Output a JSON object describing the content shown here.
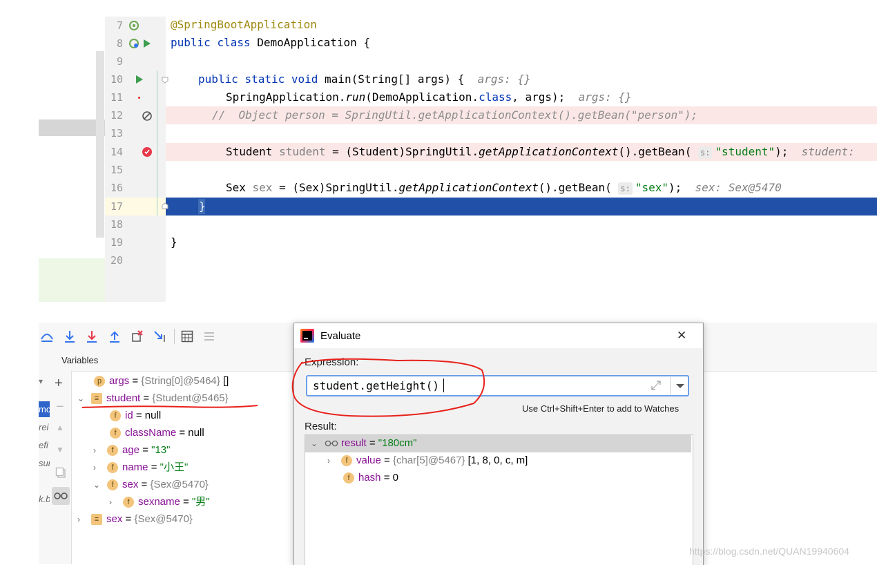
{
  "editor": {
    "line_numbers": [
      "7",
      "8",
      "9",
      "10",
      "11",
      "12",
      "13",
      "14",
      "15",
      "16",
      "17",
      "18",
      "19",
      "20"
    ],
    "lines": {
      "l7": "@SpringBootApplication",
      "l8_kw1": "public",
      "l8_kw2": "class",
      "l8_rest": " DemoApplication {",
      "l10_kw1": "public",
      "l10_kw2": "static",
      "l10_kw3": "void",
      "l10_rest": " main(String[] args) {",
      "l10_hint": "args: {}",
      "l11_a": "SpringApplication.",
      "l11_b": "run",
      "l11_c": "(DemoApplication.",
      "l11_d": "class",
      "l11_e": ", args);",
      "l11_hint": "args: {}",
      "l12": "//  Object person = SpringUtil.getApplicationContext().getBean(\"person\");",
      "l14_a": "Student ",
      "l14_b": "student",
      "l14_c": " = (Student)SpringUtil.",
      "l14_d": "getApplicationContext",
      "l14_e": "().getBean(",
      "l14_param": "s:",
      "l14_str": "\"student\"",
      "l14_f": ");",
      "l14_hint": "student:",
      "l16_a": "Sex ",
      "l16_b": "sex",
      "l16_c": " = (Sex)SpringUtil.",
      "l16_d": "getApplicationContext",
      "l16_e": "().getBean(",
      "l16_param": "s:",
      "l16_str": "\"sex\"",
      "l16_f": ");",
      "l16_hint": "sex: Sex@5470",
      "l17": "}",
      "l19": "}"
    }
  },
  "debug": {
    "variables_title": "Variables",
    "left_fragments": [
      "mc",
      "rei",
      "efi",
      "sur",
      "k.b"
    ],
    "vars": [
      {
        "badge": "p",
        "name": "args",
        "eq": " = ",
        "gray": "{String[0]@5464}",
        "rest": " []"
      },
      {
        "badge": "≡",
        "name": "student",
        "eq": " = ",
        "gray": "{Student@5465}",
        "rest": ""
      },
      {
        "badge": "f",
        "name": "id",
        "eq": " = ",
        "gray": "",
        "rest": "null"
      },
      {
        "badge": "f",
        "name": "className",
        "eq": " = ",
        "gray": "",
        "rest": "null"
      },
      {
        "badge": "f",
        "name": "age",
        "eq": " = ",
        "gray": "",
        "str": "\"13\""
      },
      {
        "badge": "f",
        "name": "name",
        "eq": " = ",
        "gray": "",
        "str": "\"小王\""
      },
      {
        "badge": "f",
        "name": "sex",
        "eq": " = ",
        "gray": "{Sex@5470}",
        "rest": ""
      },
      {
        "badge": "f",
        "name": "sexname",
        "eq": " = ",
        "gray": "",
        "str": "\"男\""
      },
      {
        "badge": "≡",
        "name": "sex",
        "eq": " = ",
        "gray": "{Sex@5470}",
        "rest": ""
      }
    ]
  },
  "dialog": {
    "title": "Evaluate",
    "close": "✕",
    "expression_label": "Expression:",
    "expression_value": "student.getHeight()",
    "hint": "Use Ctrl+Shift+Enter to add to Watches",
    "result_label": "Result:",
    "result": {
      "name": "result",
      "eq": " = ",
      "value": "\"180cm\""
    },
    "children": [
      {
        "name": "value",
        "eq": " = ",
        "gray": "{char[5]@5467}",
        "rest": " [1, 8, 0, c, m]"
      },
      {
        "name": "hash",
        "eq": " = ",
        "rest": "0"
      }
    ]
  },
  "watermark": "https://blog.csdn.net/QUAN19940604",
  "colors": {
    "selection": "#2150a8",
    "exec_line": "#fbe8e6",
    "annotation_red": "#e8201a"
  }
}
